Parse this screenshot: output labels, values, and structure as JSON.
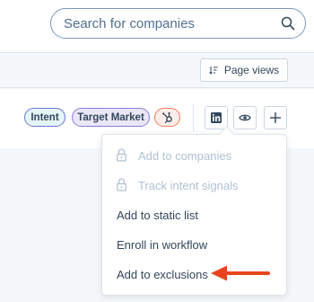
{
  "search": {
    "placeholder": "Search for companies"
  },
  "toolbar": {
    "page_views_label": "Page views"
  },
  "row": {
    "tags": [
      "Intent",
      "Target Market"
    ],
    "icons": [
      "hubspot-icon",
      "linkedin-icon",
      "eye-icon",
      "plus-icon"
    ]
  },
  "menu": {
    "items": [
      {
        "label": "Add to companies",
        "disabled": true
      },
      {
        "label": "Track intent signals",
        "disabled": true
      },
      {
        "label": "Add to static list",
        "disabled": false
      },
      {
        "label": "Enroll in workflow",
        "disabled": false
      },
      {
        "label": "Add to exclusions",
        "disabled": false
      }
    ]
  },
  "colors": {
    "accent_arrow": "#e8451e",
    "text": "#33475b",
    "disabled_text": "#b0c1d4",
    "border": "#cbd6e2"
  }
}
